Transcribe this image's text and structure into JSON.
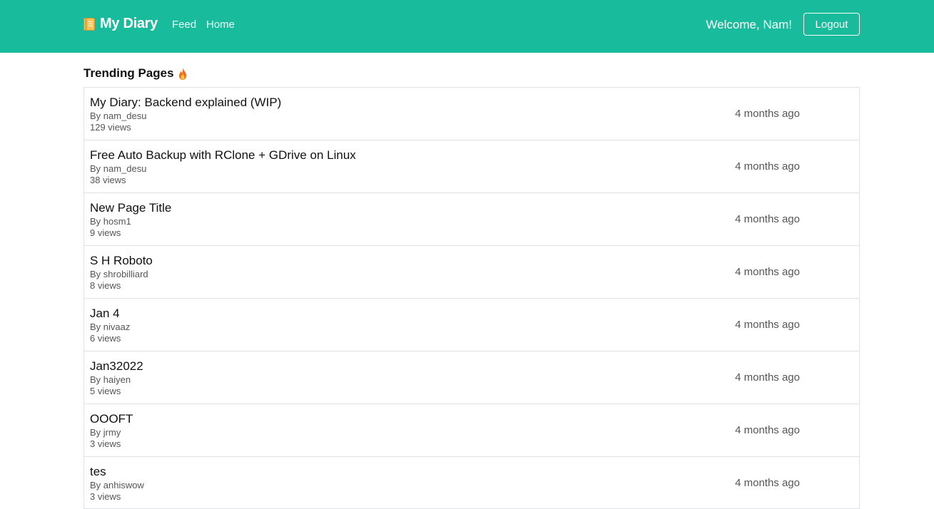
{
  "navbar": {
    "brand_label": "My Diary",
    "brand_icon": "notebook-icon",
    "links": [
      {
        "label": "Feed"
      },
      {
        "label": "Home"
      }
    ],
    "welcome_text": "Welcome, Nam!",
    "logout_label": "Logout",
    "background_color": "#18bc9c"
  },
  "main": {
    "section_title": "Trending Pages",
    "section_icon": "fire-icon",
    "pages": [
      {
        "title": "My Diary: Backend explained (WIP)",
        "author": "By nam_desu",
        "views": "129 views",
        "time": "4 months ago"
      },
      {
        "title": "Free Auto Backup with RClone + GDrive on Linux",
        "author": "By nam_desu",
        "views": "38 views",
        "time": "4 months ago"
      },
      {
        "title": "New Page Title",
        "author": "By hosm1",
        "views": "9 views",
        "time": "4 months ago"
      },
      {
        "title": "S H Roboto",
        "author": "By shrobilliard",
        "views": "8 views",
        "time": "4 months ago"
      },
      {
        "title": "Jan 4",
        "author": "By nivaaz",
        "views": "6 views",
        "time": "4 months ago"
      },
      {
        "title": "Jan32022",
        "author": "By haiyen",
        "views": "5 views",
        "time": "4 months ago"
      },
      {
        "title": "OOOFT",
        "author": "By jrmy",
        "views": "3 views",
        "time": "4 months ago"
      },
      {
        "title": "tes",
        "author": "By anhiswow",
        "views": "3 views",
        "time": "4 months ago"
      }
    ]
  }
}
